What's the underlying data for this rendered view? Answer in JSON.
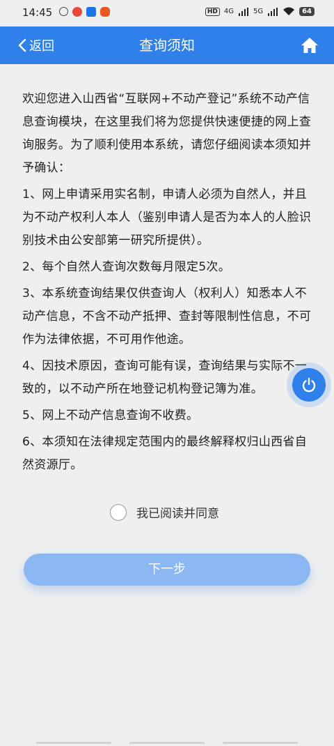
{
  "status_bar": {
    "time": "14:45",
    "network_hd": "HD",
    "network_4g": "4G",
    "network_5g": "5G",
    "battery": "64"
  },
  "navbar": {
    "back_label": "返回",
    "title": "查询须知",
    "accent_color": "#2f80ea"
  },
  "notice": {
    "intro": "欢迎您进入山西省“互联网+不动产登记”系统不动产信息查询模块，在这里我们将为您提供快速便捷的网上查询服务。为了顺利使用本系统，请您仔细阅读本须知并予确认：",
    "items": [
      "1、网上申请采用实名制，申请人必须为自然人，并且为不动产权利人本人（鉴别申请人是否为本人的人脸识别技术由公安部第一研究所提供）。",
      "2、每个自然人查询次数每月限定5次。",
      "3、本系统查询结果仅供查询人（权利人）知悉本人不动产信息，不含不动产抵押、查封等限制性信息，不可作为法律依据，不可用作他途。",
      "4、因技术原因，查询可能有误，查询结果与实际不一致的，以不动产所在地登记机构登记簿为准。",
      "5、网上不动产信息查询不收费。",
      "6、本须知在法律规定范围内的最终解释权归山西省自然资源厅。"
    ]
  },
  "agreement": {
    "label": "我已阅读并同意",
    "checked": false
  },
  "next_button": {
    "label": "下一步"
  },
  "icons": {
    "back": "chevron-left-icon",
    "home": "home-icon",
    "floating": "power-icon"
  }
}
